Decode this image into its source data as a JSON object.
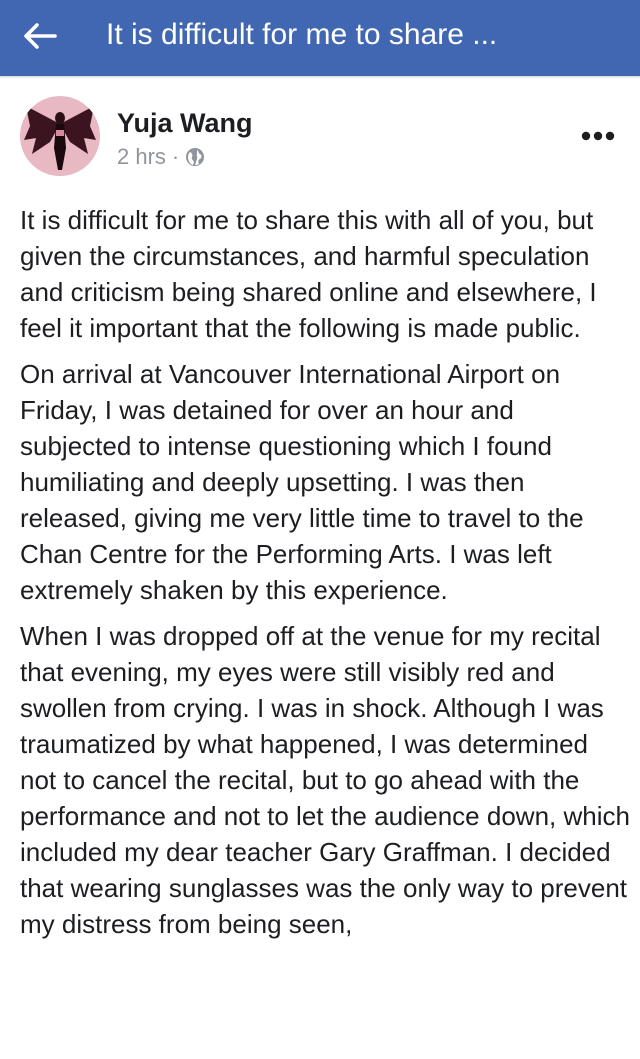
{
  "appbar": {
    "title": "It is difficult for me to share ...",
    "back_icon": "arrow-left-icon",
    "background": "#4267b2"
  },
  "post": {
    "author": "Yuja Wang",
    "timestamp": "2 hrs",
    "separator": "·",
    "privacy_icon": "globe-icon",
    "more_icon": "more-dots-icon",
    "paragraphs": [
      "It is difficult for me to share this with all of you, but given the circumstances, and harmful speculation and criticism being shared online and elsewhere, I feel it important that the following is made public.",
      "On arrival at Vancouver International Airport on Friday, I was detained for over an hour and subjected to intense questioning which I found humiliating and deeply upsetting. I was then released, giving me very little time to travel to the Chan Centre for the Performing Arts. I was left extremely shaken by this experience.",
      "When I was dropped off at the venue for my recital that evening, my eyes were still visibly red and swollen from crying. I was in shock. Although I was traumatized by what happened, I was determined not to cancel the recital, but to go ahead with the performance and not to let the audience down, which included my dear teacher Gary Graffman. I decided that wearing sunglasses was the only way to prevent my distress from being seen,"
    ]
  }
}
